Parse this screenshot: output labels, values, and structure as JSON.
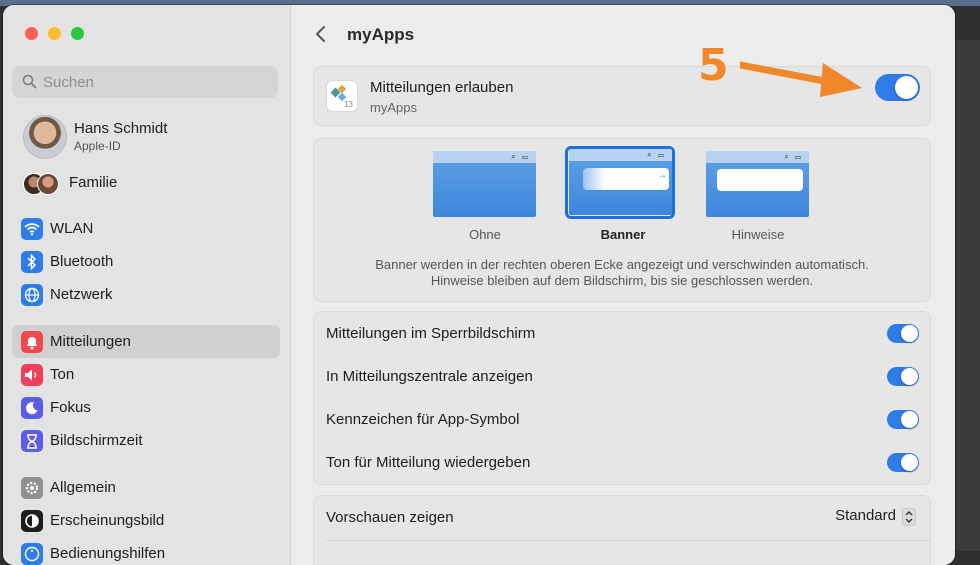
{
  "sidebar": {
    "search_placeholder": "Suchen",
    "profile": {
      "name": "Hans Schmidt",
      "subtitle": "Apple-ID"
    },
    "family": {
      "label": "Familie"
    },
    "group1": [
      {
        "label": "WLAN",
        "icon": "wifi-icon",
        "color": "#2f7be8"
      },
      {
        "label": "Bluetooth",
        "icon": "bluetooth-icon",
        "color": "#2f7be8"
      },
      {
        "label": "Netzwerk",
        "icon": "globe-icon",
        "color": "#2f7be8"
      }
    ],
    "group2": [
      {
        "label": "Mitteilungen",
        "icon": "bell-icon",
        "color": "#ef4a4a",
        "selected": true
      },
      {
        "label": "Ton",
        "icon": "speaker-icon",
        "color": "#ef3f5f"
      },
      {
        "label": "Fokus",
        "icon": "moon-icon",
        "color": "#5e5ce6"
      },
      {
        "label": "Bildschirmzeit",
        "icon": "hourglass-icon",
        "color": "#5e5ce6"
      }
    ],
    "group3": [
      {
        "label": "Allgemein",
        "icon": "gear-icon",
        "color": "#8e8e93"
      },
      {
        "label": "Erscheinungsbild",
        "icon": "appearance-icon",
        "color": "#1d1d1f"
      },
      {
        "label": "Bedienungshilfen",
        "icon": "accessibility-icon",
        "color": "#2f7be8"
      }
    ]
  },
  "header": {
    "title": "myApps"
  },
  "allow": {
    "title": "Mitteilungen erlauben",
    "subtitle": "myApps",
    "enabled": true
  },
  "annotation": {
    "number": "5"
  },
  "styles": {
    "options": [
      {
        "label": "Ohne",
        "selected": false
      },
      {
        "label": "Banner",
        "selected": true
      },
      {
        "label": "Hinweise",
        "selected": false
      }
    ],
    "description_line1": "Banner werden in der rechten oberen Ecke angezeigt und verschwinden automatisch.",
    "description_line2": "Hinweise bleiben auf dem Bildschirm, bis sie geschlossen werden."
  },
  "toggles": [
    {
      "label": "Mitteilungen im Sperrbildschirm",
      "enabled": true
    },
    {
      "label": "In Mitteilungszentrale anzeigen",
      "enabled": true
    },
    {
      "label": "Kennzeichen für App-Symbol",
      "enabled": true
    },
    {
      "label": "Ton für Mitteilung wiedergeben",
      "enabled": true
    }
  ],
  "preview": {
    "label": "Vorschauen zeigen",
    "value": "Standard"
  },
  "colors": {
    "accent": "#2f7be8",
    "annotation": "#f0872a"
  }
}
